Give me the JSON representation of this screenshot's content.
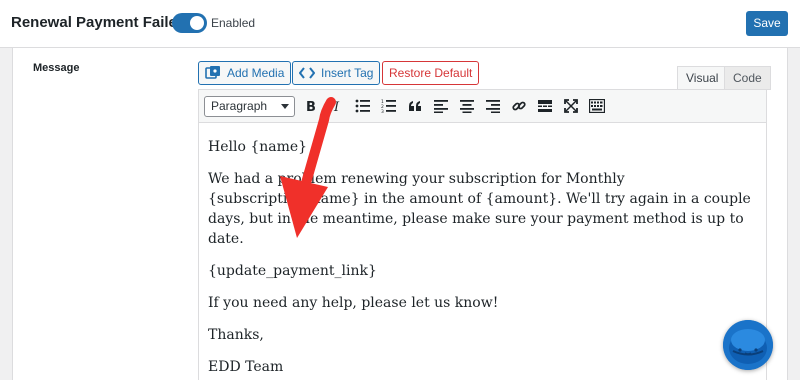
{
  "header": {
    "title": "Renewal Payment Failed",
    "toggle_label": "Enabled",
    "toggle_enabled": true,
    "save_label": "Save"
  },
  "field": {
    "label": "Message"
  },
  "media_buttons": {
    "add_media": "Add Media",
    "insert_tag": "Insert Tag",
    "restore_default": "Restore Default"
  },
  "tabs": {
    "visual": "Visual",
    "code": "Code",
    "active": "visual"
  },
  "toolbar": {
    "format_value": "Paragraph",
    "icons": [
      "bold-icon",
      "italic-icon",
      "bulleted-list-icon",
      "numbered-list-icon",
      "blockquote-icon",
      "align-left-icon",
      "align-center-icon",
      "align-right-icon",
      "link-icon",
      "read-more-icon",
      "fullscreen-icon",
      "toolbar-toggle-icon"
    ]
  },
  "content": {
    "paragraphs": [
      "Hello {name}",
      "We had a problem renewing your subscription for Monthly {subscription_name} in the amount of {amount}. We'll try again in a couple days, but in the meantime, please make sure your payment method is up to date.",
      "{update_payment_link}",
      "If you need any help, please let us know!",
      "Thanks,",
      "EDD Team"
    ]
  },
  "colors": {
    "primary": "#2271b1",
    "danger": "#d63638",
    "annotation_arrow": "#f0302a",
    "chat_bubble": "#1a73c9"
  }
}
